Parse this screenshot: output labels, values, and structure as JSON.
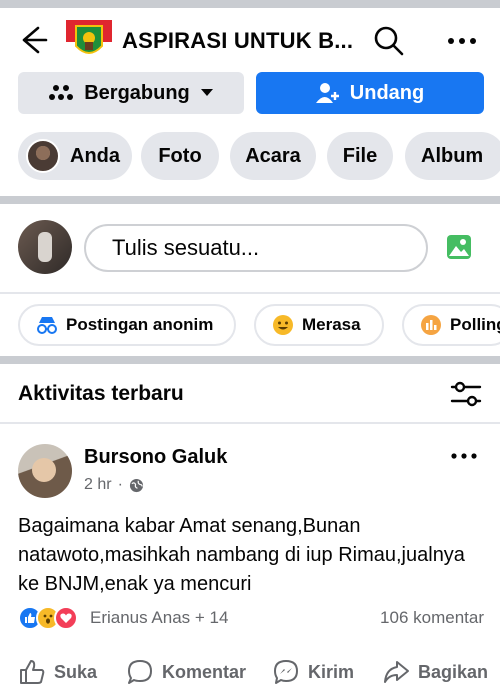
{
  "header": {
    "title": "ASPIRASI UNTUK B...",
    "back_icon": "arrow-left-icon",
    "search_icon": "search-icon",
    "more_icon": "more-horizontal-icon"
  },
  "actions": {
    "join_label": "Bergabung",
    "invite_label": "Undang"
  },
  "tabs": [
    "Anda",
    "Foto",
    "Acara",
    "File",
    "Album"
  ],
  "composer": {
    "placeholder": "Tulis sesuatu..."
  },
  "quick_actions": [
    "Postingan anonim",
    "Merasa",
    "Polling"
  ],
  "activity": {
    "title": "Aktivitas terbaru"
  },
  "post": {
    "author": "Bursono Galuk",
    "time": "2 hr",
    "separator": "·",
    "text": "Bagaimana kabar Amat senang,Bunan natawoto,masihkah nambang di iup Rimau,jualnya ke BNJM,enak ya mencuri",
    "reaction_names": "Erianus Anas + 14",
    "comments": "106 komentar"
  },
  "post_actions": [
    "Suka",
    "Komentar",
    "Kirim",
    "Bagikan"
  ],
  "colors": {
    "brand_blue": "#1877f2",
    "chip_bg": "#e4e6eb",
    "secondary_text": "#65676b",
    "divider": "#c9ccd1"
  }
}
